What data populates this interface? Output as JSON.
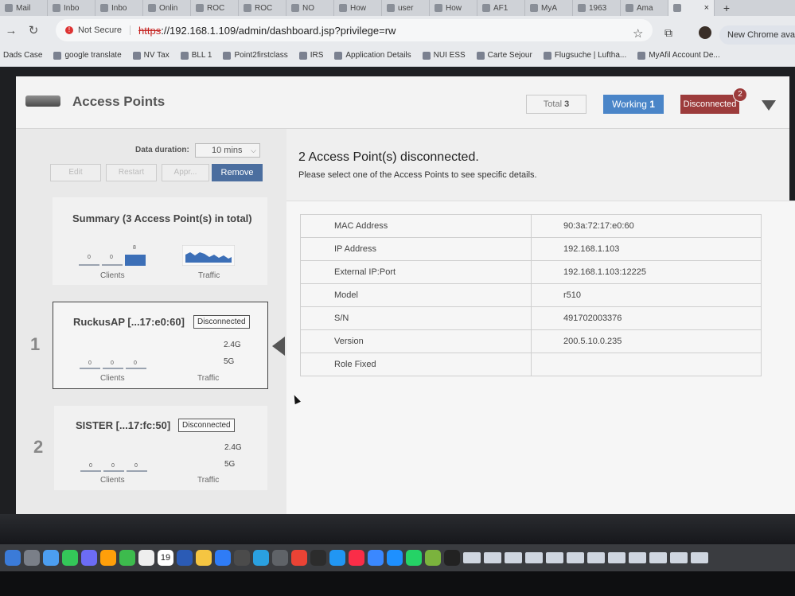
{
  "browser": {
    "tabs": [
      {
        "label": "Mail"
      },
      {
        "label": "Inbo"
      },
      {
        "label": "Inbo"
      },
      {
        "label": "Onlin"
      },
      {
        "label": "ROC"
      },
      {
        "label": "ROC"
      },
      {
        "label": "NO"
      },
      {
        "label": "How"
      },
      {
        "label": "user"
      },
      {
        "label": "How"
      },
      {
        "label": "AF1"
      },
      {
        "label": "MyA"
      },
      {
        "label": "1963"
      },
      {
        "label": "Ama"
      }
    ],
    "active_tab_close": "×",
    "new_tab": "+",
    "back": "←",
    "forward": "→",
    "reload": "↻",
    "security_label": "Not Secure",
    "url_scheme": "https",
    "url_rest": "://192.168.1.109/admin/dashboard.jsp?privilege=rw",
    "update_button": "New Chrome avail"
  },
  "bookmarks": [
    "Dads Case",
    "google translate",
    "NV Tax",
    "BLL 1",
    "Point2firstclass",
    "IRS",
    "Application Details",
    "NUI ESS",
    "Carte Sejour",
    "Flugsuche | Luftha...",
    "MyAfil Account De..."
  ],
  "header": {
    "title": "Access Points",
    "total_label": "Total",
    "total_count": "3",
    "working_label": "Working",
    "working_count": "1",
    "disconnected_label": "Disconnected",
    "disconnected_badge": "2"
  },
  "controls": {
    "duration_label": "Data duration:",
    "duration_value": "10 mins",
    "edit": "Edit",
    "restart": "Restart",
    "approve": "Appr...",
    "remove": "Remove"
  },
  "summary": {
    "title": "Summary (3 Access Point(s) in total)",
    "client_counts": [
      "0",
      "0",
      "8"
    ],
    "clients_label": "Clients",
    "traffic_label": "Traffic"
  },
  "aps": [
    {
      "index": "1",
      "name": "RuckusAP [...17:e0:60]",
      "status": "Disconnected",
      "band1": "2.4G",
      "band2": "5G",
      "counts": [
        "0",
        "0",
        "0"
      ],
      "clients_label": "Clients",
      "traffic_label": "Traffic"
    },
    {
      "index": "2",
      "name": "SISTER [...17:fc:50]",
      "status": "Disconnected",
      "band1": "2.4G",
      "band2": "5G",
      "counts": [
        "0",
        "0",
        "0"
      ],
      "clients_label": "Clients",
      "traffic_label": "Traffic"
    }
  ],
  "main": {
    "heading": "2 Access Point(s) disconnected.",
    "subheading": "Please select one of the Access Points to see specific details."
  },
  "details": [
    {
      "key": "MAC Address",
      "value": "90:3a:72:17:e0:60"
    },
    {
      "key": "IP Address",
      "value": "192.168.1.103"
    },
    {
      "key": "External IP:Port",
      "value": "192.168.1.103:12225"
    },
    {
      "key": "Model",
      "value": "r510"
    },
    {
      "key": "S/N",
      "value": "491702003376"
    },
    {
      "key": "Version",
      "value": "200.5.10.0.235"
    },
    {
      "key": "Role Fixed",
      "value": ""
    }
  ],
  "dock": {
    "calendar_day": "19",
    "icon_colors": [
      "#3b7bd8",
      "#7a7f88",
      "#4c9ef0",
      "#34c759",
      "#6c6cf5",
      "#ff9f0a",
      "#3dbb4d",
      "#eeeeee",
      "#1f8f48",
      "#2b5bb5",
      "#f5c542",
      "#2f7cf6",
      "#4b4b4b",
      "#2aa0e0",
      "#5f6368",
      "#ea4335",
      "#2c2c2c",
      "#2196f3",
      "#fa2d48",
      "#3a88ff",
      "#1e90ff",
      "#25d366",
      "#7bb33d",
      "#222222"
    ]
  }
}
